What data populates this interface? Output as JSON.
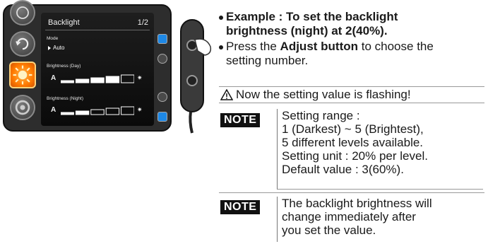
{
  "screen": {
    "title": "Backlight",
    "page": "1/2",
    "mode_label": "Mode",
    "mode_value": "Auto",
    "day_label": "Brightness (Day)",
    "night_label": "Brightness (Night)",
    "a_mark": "A",
    "day_level": 4,
    "night_level": 2,
    "max_level": 5,
    "accent_color": "#ff7a00"
  },
  "instructions": {
    "example_prefix": "Example : To set the",
    "example_highlight_1": "backlight",
    "example_line2": "brightness (night) at 2(40%).",
    "press_prefix": "Press the",
    "press_bold": "Adjust button",
    "press_suffix": "to choose the",
    "press_line2": "setting number.",
    "warning": "Now the setting value is flashing!"
  },
  "note1": {
    "label": "NOTE",
    "lines": [
      "Setting range :",
      "1 (Darkest) ~ 5 (Brightest),",
      "5 different levels available.",
      "Setting unit : 20% per level.",
      "Default value : 3(60%)."
    ]
  },
  "note2": {
    "label": "NOTE",
    "lines": [
      "The backlight brightness will",
      "change immediately after",
      "you set the value."
    ]
  },
  "icons": [
    "compass-icon",
    "refresh-icon",
    "sun-icon",
    "tire-icon",
    "warning-icon",
    "hand-pointer-icon"
  ]
}
